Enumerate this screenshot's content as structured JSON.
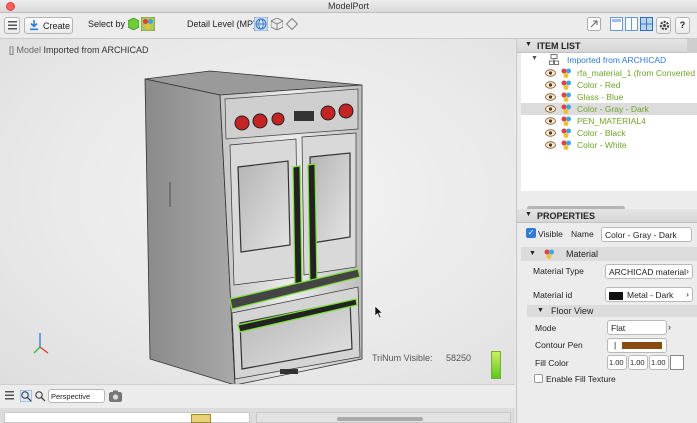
{
  "window": {
    "title": "ModelPort"
  },
  "toolbar": {
    "create_label": "Create",
    "select_by_label": "Select by",
    "detail_level_label": "Detail Level (MP)",
    "help_label": "?"
  },
  "viewport": {
    "breadcrumb_prefix": "[] Model",
    "breadcrumb_name": "Imported from ARCHICAD",
    "trinum_label": "TriNum Visible:",
    "trinum_value": "58250",
    "projection_value": "Perspective"
  },
  "item_list": {
    "header": "ITEM LIST",
    "root": "Imported from ARCHICAD",
    "items": [
      "rfa_material_1 (from Converted",
      "Color - Red",
      "Glass - Blue",
      "Color - Gray - Dark",
      "PEN_MATERIAL4",
      "Color - Black",
      "Color - White"
    ],
    "selected_index": 3
  },
  "properties": {
    "header": "PROPERTIES",
    "visible_label": "Visible",
    "visible_checked": true,
    "name_label": "Name",
    "name_value": "Color - Gray - Dark",
    "material_section": "Material",
    "material_type_label": "Material Type",
    "material_type_value": "ARCHICAD material",
    "material_id_label": "Material id",
    "material_id_value": "Metal - Dark",
    "floor_view_section": "Floor View",
    "mode_label": "Mode",
    "mode_value": "Flat",
    "contour_pen_label": "Contour Pen",
    "contour_pen_number": "|",
    "contour_pen_color": "#8a4a10",
    "fill_color_label": "Fill Color",
    "fill_color_values": [
      "1.00",
      "1.00",
      "1.00"
    ],
    "enable_fill_texture_label": "Enable Fill Texture",
    "enable_fill_texture_checked": false
  },
  "colors": {
    "accent_blue": "#2f7bd8",
    "item_green": "#6fa52a",
    "selection_green": "#7ee03a"
  }
}
